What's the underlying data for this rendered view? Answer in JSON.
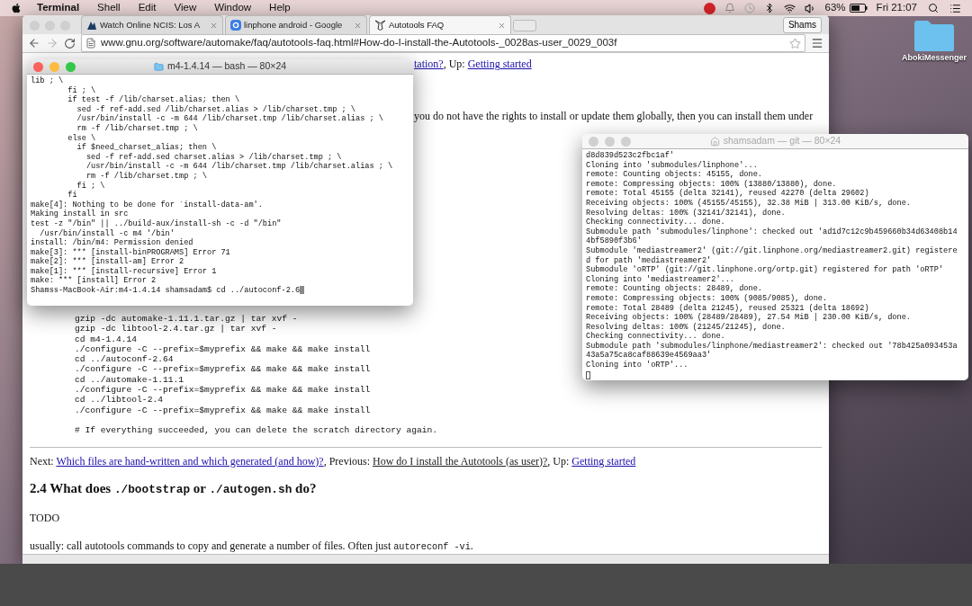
{
  "menu_bar": {
    "app": "Terminal",
    "menus": [
      "Shell",
      "Edit",
      "View",
      "Window",
      "Help"
    ],
    "battery": "63%",
    "clock": "Fri 21:07"
  },
  "desktop_icons": [
    {
      "label": "AbokiMessenger"
    }
  ],
  "browser": {
    "profile": "Shams",
    "tabs": [
      {
        "title": "Watch Online NCIS: Los A",
        "selected": false,
        "kind": "video"
      },
      {
        "title": "linphone android - Google",
        "selected": false,
        "kind": "google"
      },
      {
        "title": "Autotools FAQ",
        "selected": true,
        "kind": "gnu"
      }
    ],
    "url": "www.gnu.org/software/automake/faq/autotools-faq.html#How-do-I-install-the-Autotools-_0028as-user_0029_003f",
    "page": {
      "top_nav": [
        {
          "kind": "link",
          "text": "tation?"
        },
        {
          "kind": "text",
          "text": ", Up: "
        },
        {
          "kind": "link",
          "text": "Getting started"
        }
      ],
      "intro": "you do not have the rights to install or update them globally, then you can install them under",
      "code_lines": [
        "    gzip -dc automake-1.11.1.tar.gz | tar xvf -",
        "    gzip -dc libtool-2.4.tar.gz | tar xvf -",
        "    cd m4-1.4.14",
        "    ./configure -C --prefix=$myprefix && make && make install",
        "    cd ../autoconf-2.64",
        "    ./configure -C --prefix=$myprefix && make && make install",
        "    cd ../automake-1.11.1",
        "    ./configure -C --prefix=$myprefix && make && make install",
        "    cd ../libtool-2.4",
        "    ./configure -C --prefix=$myprefix && make && make install"
      ],
      "comment": "    # If everything succeeded, you can delete the scratch directory again.",
      "nav": [
        {
          "kind": "text",
          "text": "Next: "
        },
        {
          "kind": "link",
          "text": "Which files are hand-written and which generated (and how)?"
        },
        {
          "kind": "text",
          "text": ", Previous: "
        },
        {
          "kind": "visited",
          "text": "How do I install the Autotools (as user)?"
        },
        {
          "kind": "text",
          "text": ", Up: "
        },
        {
          "kind": "link",
          "text": "Getting started"
        }
      ],
      "heading": [
        {
          "kind": "text",
          "text": "2.4 What does "
        },
        {
          "kind": "code",
          "text": "./bootstrap"
        },
        {
          "kind": "text",
          "text": " or "
        },
        {
          "kind": "code",
          "text": "./autogen.sh"
        },
        {
          "kind": "text",
          "text": " do?"
        }
      ],
      "paragraphs": [
        [
          {
            "kind": "text",
            "text": "TODO"
          }
        ],
        [
          {
            "kind": "text",
            "text": "usually: call autotools commands to copy and generate a number of files. Often just "
          },
          {
            "kind": "code",
            "text": "autoreconf -vi"
          },
          {
            "kind": "text",
            "text": "."
          }
        ]
      ]
    }
  },
  "terminals": [
    {
      "title": "m4-1.4.14 — bash — 80×24",
      "active": true,
      "kind": "folder",
      "lines": [
        "lib ; \\",
        "        fi ; \\",
        "        if test -f /lib/charset.alias; then \\",
        "          sed -f ref-add.sed /lib/charset.alias > /lib/charset.tmp ; \\",
        "          /usr/bin/install -c -m 644 /lib/charset.tmp /lib/charset.alias ; \\",
        "          rm -f /lib/charset.tmp ; \\",
        "        else \\",
        "          if $need_charset_alias; then \\",
        "            sed -f ref-add.sed charset.alias > /lib/charset.tmp ; \\",
        "            /usr/bin/install -c -m 644 /lib/charset.tmp /lib/charset.alias ; \\",
        "            rm -f /lib/charset.tmp ; \\",
        "          fi ; \\",
        "        fi",
        "make[4]: Nothing to be done for `install-data-am'.",
        "Making install in src",
        "test -z \"/bin\" || ../build-aux/install-sh -c -d \"/bin\"",
        "  /usr/bin/install -c m4 '/bin'",
        "install: /bin/m4: Permission denied",
        "make[3]: *** [install-binPROGRAMS] Error 71",
        "make[2]: *** [install-am] Error 2",
        "make[1]: *** [install-recursive] Error 1",
        "make: *** [install] Error 2",
        "Shamss-MacBook-Air:m4-1.4.14 shamsadam$ cd ../autoconf-2.6"
      ]
    },
    {
      "title": "shamsadam — git — 80×24",
      "active": false,
      "kind": "home",
      "lines": [
        "d8d839d523c2fbc1af'",
        "Cloning into 'submodules/linphone'...",
        "remote: Counting objects: 45155, done.",
        "remote: Compressing objects: 100% (13880/13880), done.",
        "remote: Total 45155 (delta 32141), reused 42270 (delta 29602)",
        "Receiving objects: 100% (45155/45155), 32.38 MiB | 313.00 KiB/s, done.",
        "Resolving deltas: 100% (32141/32141), done.",
        "Checking connectivity... done.",
        "Submodule path 'submodules/linphone': checked out 'ad1d7c12c9b459660b34d63408b14",
        "4bf5890f3b6'",
        "Submodule 'mediastreamer2' (git://git.linphone.org/mediastreamer2.git) registere",
        "d for path 'mediastreamer2'",
        "Submodule 'oRTP' (git://git.linphone.org/ortp.git) registered for path 'oRTP'",
        "Cloning into 'mediastreamer2'...",
        "remote: Counting objects: 28489, done.",
        "remote: Compressing objects: 100% (9085/9085), done.",
        "remote: Total 28489 (delta 21245), reused 25321 (delta 18692)",
        "Receiving objects: 100% (28489/28489), 27.54 MiB | 230.00 KiB/s, done.",
        "Resolving deltas: 100% (21245/21245), done.",
        "Checking connectivity... done.",
        "Submodule path 'submodules/linphone/mediastreamer2': checked out '78b425a093453a",
        "43a5a75ca8caf88639e4569aa3'",
        "Cloning into 'oRTP'..."
      ]
    }
  ]
}
